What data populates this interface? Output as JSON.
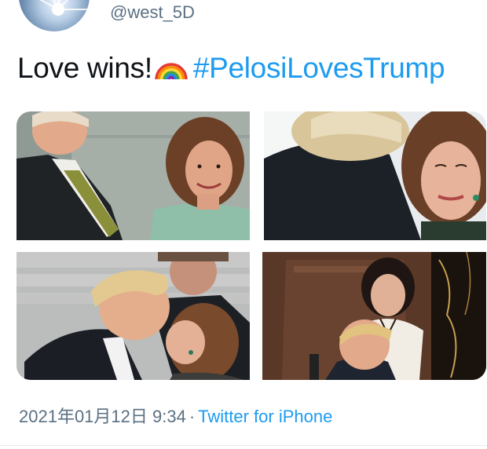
{
  "tweet": {
    "handle": "@west_5D",
    "text_prefix": "Love wins!",
    "emoji_icon": "rainbow-emoji",
    "hashtag": "#PelosiLovesTrump",
    "timestamp": "2021年01月12日 9:34",
    "separator": "·",
    "source": "Twitter for iPhone"
  },
  "colors": {
    "link": "#1d9bf0",
    "secondary_text": "#5b7083",
    "primary_text": "#0f1419"
  }
}
